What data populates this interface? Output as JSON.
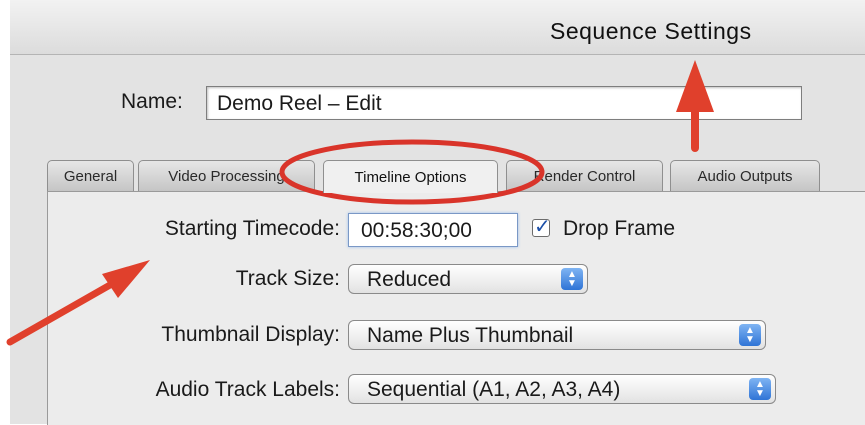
{
  "window": {
    "title": "Sequence Settings"
  },
  "name_field": {
    "label": "Name:",
    "value": "Demo Reel – Edit"
  },
  "tabs": [
    {
      "label": "General",
      "active": false
    },
    {
      "label": "Video Processing",
      "active": false
    },
    {
      "label": "Timeline Options",
      "active": true
    },
    {
      "label": "Render Control",
      "active": false
    },
    {
      "label": "Audio Outputs",
      "active": false
    }
  ],
  "timeline_options": {
    "starting_timecode": {
      "label": "Starting Timecode:",
      "value": "00:58:30;00"
    },
    "drop_frame": {
      "label": "Drop Frame",
      "checked": true
    },
    "track_size": {
      "label": "Track Size:",
      "value": "Reduced"
    },
    "thumbnail_display": {
      "label": "Thumbnail Display:",
      "value": "Name Plus Thumbnail"
    },
    "audio_track_labels": {
      "label": "Audio Track Labels:",
      "value": "Sequential (A1, A2, A3, A4)"
    }
  },
  "annotation_colors": {
    "arrow": "#e0402c",
    "ellipse": "#d9342a"
  }
}
